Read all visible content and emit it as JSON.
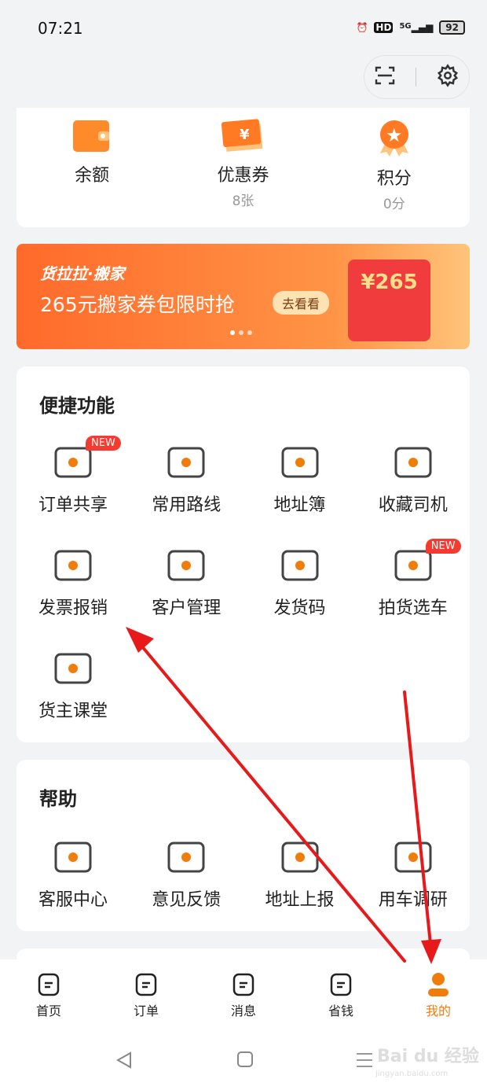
{
  "status": {
    "time": "07:21",
    "hd": "HD",
    "network": "5G",
    "battery": "92"
  },
  "assets": [
    {
      "label": "余额",
      "sub": ""
    },
    {
      "label": "优惠券",
      "sub": "8张"
    },
    {
      "label": "积分",
      "sub": "0分"
    }
  ],
  "banner": {
    "brand": "货拉拉·搬家",
    "title": "265元搬家券包限时抢",
    "button": "去看看",
    "amount": "¥265"
  },
  "quick": {
    "title": "便捷功能",
    "new_badge": "NEW",
    "items": [
      {
        "label": "订单共享",
        "icon": "order-share-icon",
        "new": true
      },
      {
        "label": "常用路线",
        "icon": "route-icon"
      },
      {
        "label": "地址簿",
        "icon": "address-book-icon"
      },
      {
        "label": "收藏司机",
        "icon": "favorite-driver-icon"
      },
      {
        "label": "发票报销",
        "icon": "invoice-icon"
      },
      {
        "label": "客户管理",
        "icon": "customer-card-icon"
      },
      {
        "label": "发货码",
        "icon": "qr-code-icon"
      },
      {
        "label": "拍货选车",
        "icon": "scan-truck-icon",
        "new": true
      },
      {
        "label": "货主课堂",
        "icon": "video-class-icon"
      }
    ]
  },
  "help": {
    "title": "帮助",
    "items": [
      {
        "label": "客服中心",
        "icon": "customer-service-icon"
      },
      {
        "label": "意见反馈",
        "icon": "feedback-icon"
      },
      {
        "label": "地址上报",
        "icon": "address-report-icon"
      },
      {
        "label": "用车调研",
        "icon": "survey-icon"
      }
    ]
  },
  "nav": [
    {
      "label": "首页"
    },
    {
      "label": "订单"
    },
    {
      "label": "消息"
    },
    {
      "label": "省钱"
    },
    {
      "label": "我的",
      "active": true
    }
  ],
  "watermark": {
    "main": "Bai du 经验",
    "sub": "jingyan.baidu.com"
  },
  "colors": {
    "accent": "#f07c0a",
    "annotation": "#e8191a"
  }
}
